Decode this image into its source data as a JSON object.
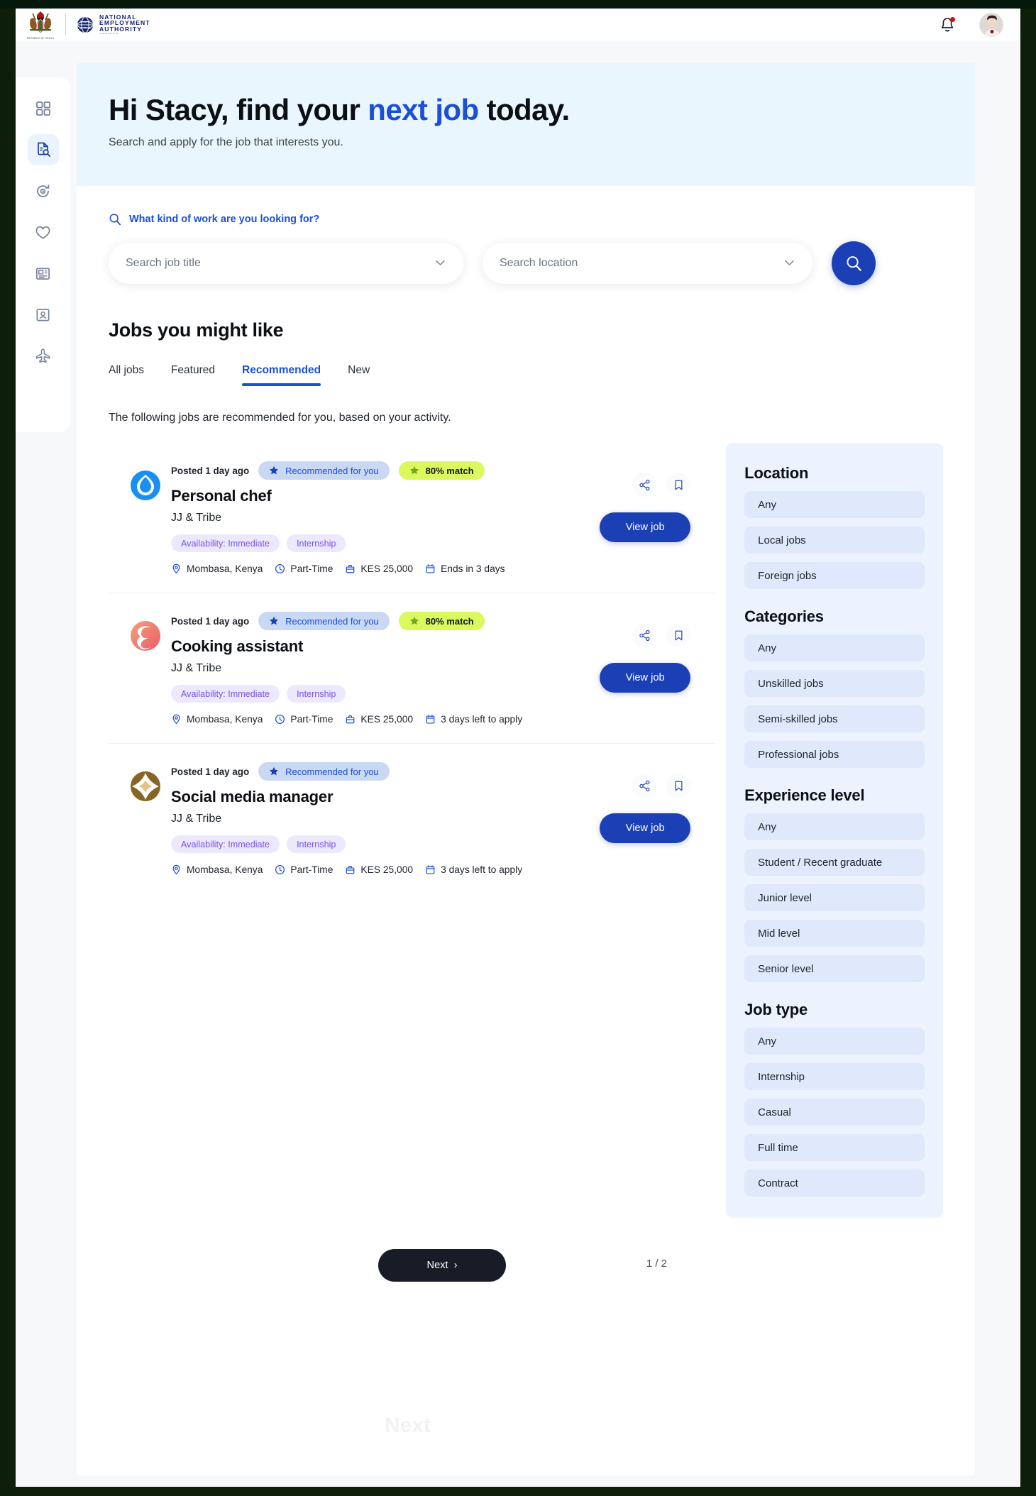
{
  "header": {
    "coat_caption": "REPUBLIC OF KENYA",
    "org_line1": "NATIONAL",
    "org_line2": "EMPLOYMENT",
    "org_line3": "AUTHORITY",
    "org_tagline": "Creating jobs for all",
    "bell_icon": "bell-icon",
    "avatar_alt": "user-avatar"
  },
  "rail": {
    "items": [
      {
        "name": "dashboard",
        "icon": "grid-icon",
        "active": false
      },
      {
        "name": "jobs",
        "icon": "document-search-icon",
        "active": true
      },
      {
        "name": "applications",
        "icon": "refresh-history-icon",
        "active": false
      },
      {
        "name": "saved",
        "icon": "heart-icon",
        "active": false
      },
      {
        "name": "news",
        "icon": "newspaper-icon",
        "active": false
      },
      {
        "name": "profile",
        "icon": "id-card-icon",
        "active": false
      },
      {
        "name": "travel",
        "icon": "airplane-icon",
        "active": false
      }
    ]
  },
  "hero": {
    "greeting_prefix": "Hi Stacy, find your ",
    "greeting_accent": "next job",
    "greeting_suffix": " today.",
    "subtitle": "Search and apply for the job that interests you."
  },
  "search": {
    "label": "What kind of work are you looking for?",
    "job_placeholder": "Search job title",
    "job_value": "",
    "location_placeholder": "Search location",
    "location_value": "",
    "search_icon": "search-icon",
    "accent": "#1b3fb5"
  },
  "jobs_section": {
    "title": "Jobs you might like",
    "tabs": [
      {
        "label": "All jobs",
        "active": false
      },
      {
        "label": "Featured",
        "active": false
      },
      {
        "label": "Recommended",
        "active": true
      },
      {
        "label": "New",
        "active": false
      }
    ],
    "note": "The following jobs are recommended for you, based on your activity.",
    "view_job_label": "View job",
    "cards": [
      {
        "posted": "Posted 1 day ago",
        "recommended_label": "Recommended for you",
        "match_label": "80% match",
        "has_match": true,
        "title": "Personal chef",
        "company": "JJ & Tribe",
        "tags": [
          "Availability: Immediate",
          "Internship"
        ],
        "location": "Mombasa, Kenya",
        "schedule": "Part-Time",
        "salary": "KES 25,000",
        "deadline": "Ends in 3 days",
        "logo_kind": "blue-drop"
      },
      {
        "posted": "Posted 1 day ago",
        "recommended_label": "Recommended for you",
        "match_label": "80% match",
        "has_match": true,
        "title": "Cooking assistant",
        "company": "JJ & Tribe",
        "tags": [
          "Availability: Immediate",
          "Internship"
        ],
        "location": "Mombasa, Kenya",
        "schedule": "Part-Time",
        "salary": "KES 25,000",
        "deadline": "3 days left to apply",
        "logo_kind": "coral-swirl"
      },
      {
        "posted": "Posted 1 day ago",
        "recommended_label": "Recommended for you",
        "match_label": "",
        "has_match": false,
        "title": "Social media manager",
        "company": "JJ & Tribe",
        "tags": [
          "Availability: Immediate",
          "Internship"
        ],
        "location": "Mombasa, Kenya",
        "schedule": "Part-Time",
        "salary": "KES 25,000",
        "deadline": "3 days left to apply",
        "logo_kind": "brown-star"
      }
    ]
  },
  "filters": {
    "groups": [
      {
        "title": "Location",
        "options": [
          "Any",
          "Local jobs",
          "Foreign jobs"
        ]
      },
      {
        "title": "Categories",
        "options": [
          "Any",
          "Unskilled jobs",
          "Semi-skilled jobs",
          "Professional jobs"
        ]
      },
      {
        "title": "Experience level",
        "options": [
          "Any",
          "Student / Recent graduate",
          "Junior level",
          "Mid level",
          "Senior level"
        ]
      },
      {
        "title": "Job type",
        "options": [
          "Any",
          "Internship",
          "Casual",
          "Full time",
          "Contract"
        ]
      }
    ]
  },
  "pagination": {
    "next_label": "Next",
    "next_chevron": "›",
    "counter": "1 / 2"
  },
  "watermark": {
    "text": "Next"
  },
  "colors": {
    "primary_blue": "#1b3fb5",
    "link_blue": "#1b4fd8",
    "hero_bg": "#eaf6fd",
    "filter_bg": "#edf3fe",
    "chip_bg": "#e0e9fb",
    "match_green": "#dcf85f",
    "tag_purple_bg": "#ece8fd",
    "tag_purple_fg": "#7a53e8",
    "dark_button": "#181c26"
  }
}
